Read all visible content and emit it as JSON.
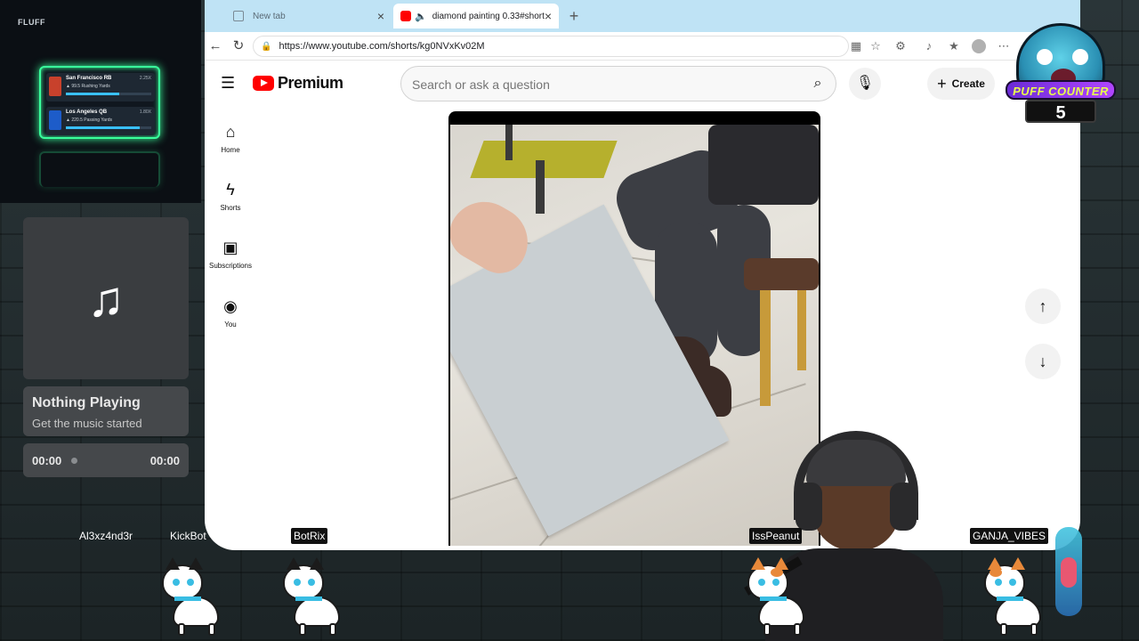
{
  "overlay": {
    "brand": "FLUFF",
    "ticker": [
      {
        "team": "San Francisco",
        "position": "RB",
        "stat": "▲ 99.5 Rushing Yards",
        "line": "2.25X",
        "bar": 0.62,
        "color": "#c8412c"
      },
      {
        "team": "Los Angeles",
        "position": "QB",
        "stat": "▲ 220.5 Passing Yards",
        "line": "1.80X",
        "bar": 0.86,
        "color": "#1d5cc9"
      }
    ]
  },
  "music": {
    "title": "Nothing Playing",
    "subtitle": "Get the music started",
    "elapsed": "00:00",
    "duration": "00:00",
    "note_icon": "music-note-icon"
  },
  "browser": {
    "tabs": [
      {
        "title": "New tab",
        "active": false
      },
      {
        "title": "diamond painting 0.33#shorts",
        "active": true
      }
    ],
    "url": "https://www.youtube.com/shorts/kg0NVxKv02M"
  },
  "youtube": {
    "logo_word": "Premium",
    "search_placeholder": "Search or ask a question",
    "create_label": "Create",
    "rail": [
      {
        "label": "Home",
        "icon": "home-icon"
      },
      {
        "label": "Shorts",
        "icon": "shorts-icon"
      },
      {
        "label": "Subscriptions",
        "icon": "subscriptions-icon"
      },
      {
        "label": "You",
        "icon": "you-icon"
      }
    ],
    "brand_color": "#ff0000"
  },
  "puff_counter": {
    "title": "PUFF COUNTER",
    "count": "5"
  },
  "chatters": [
    {
      "name": "Al3xz4nd3r",
      "boxed": false
    },
    {
      "name": "KickBot",
      "boxed": false
    },
    {
      "name": "BotRix",
      "boxed": true
    },
    {
      "name": "IssPeanut",
      "boxed": true
    },
    {
      "name": "GANJA_VIBES",
      "boxed": true
    }
  ],
  "colors": {
    "ticker_glow": "#39ff9c",
    "tabstrip": "#bfe3f5",
    "puff_title_text": "#e9ff4a"
  }
}
